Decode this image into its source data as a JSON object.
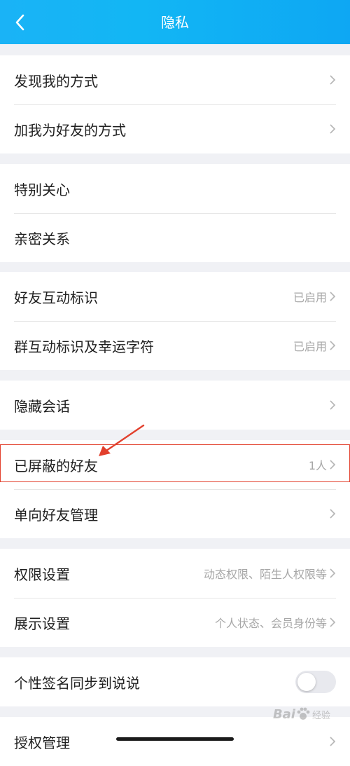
{
  "header": {
    "title": "隐私"
  },
  "sections": [
    {
      "rows": [
        {
          "label": "发现我的方式"
        },
        {
          "label": "加我为好友的方式"
        }
      ]
    },
    {
      "rows": [
        {
          "label": "特别关心"
        },
        {
          "label": "亲密关系"
        }
      ]
    },
    {
      "rows": [
        {
          "label": "好友互动标识",
          "value": "已启用"
        },
        {
          "label": "群互动标识及幸运字符",
          "value": "已启用"
        }
      ]
    },
    {
      "rows": [
        {
          "label": "隐藏会话"
        }
      ]
    },
    {
      "rows": [
        {
          "label": "已屏蔽的好友",
          "value": "1人"
        },
        {
          "label": "单向好友管理"
        }
      ]
    },
    {
      "rows": [
        {
          "label": "权限设置",
          "value": "动态权限、陌生人权限等"
        },
        {
          "label": "展示设置",
          "value": "个人状态、会员身份等"
        }
      ]
    },
    {
      "rows": [
        {
          "label": "个性签名同步到说说",
          "toggle": false
        }
      ]
    },
    {
      "rows": [
        {
          "label": "授权管理"
        }
      ]
    }
  ],
  "colors": {
    "header": "#12b6f4",
    "highlight": "#e2402d"
  },
  "watermark": {
    "text": "Bai",
    "suffix": "经验"
  }
}
